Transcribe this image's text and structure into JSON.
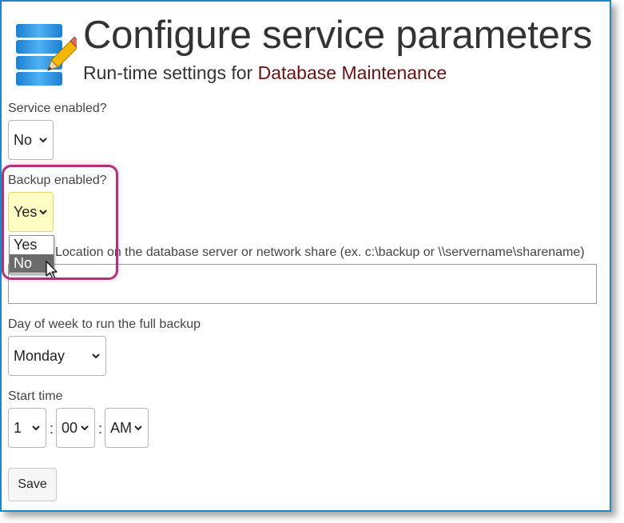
{
  "header": {
    "title": "Configure service parameters",
    "subtitle_prefix": "Run-time settings for",
    "service_name": "Database Maintenance"
  },
  "service_enabled": {
    "label": "Service enabled?",
    "value": "No"
  },
  "backup_enabled": {
    "label": "Backup enabled?",
    "value": "Yes",
    "options": [
      "Yes",
      "No"
    ],
    "hovered_option": "No"
  },
  "backup_location": {
    "label": "Location on the database server or network share (ex. c:\\backup or \\\\servername\\sharename)",
    "value": ""
  },
  "day_of_week": {
    "label": "Day of week to run the full backup",
    "value": "Monday"
  },
  "start_time": {
    "label": "Start time",
    "hour": "1",
    "minute": "00",
    "ampm": "AM",
    "separator": ":"
  },
  "save_button": {
    "label": "Save"
  },
  "colors": {
    "frame_border": "#1e88c7",
    "service_name": "#6a1010",
    "highlight_ring": "#b3307a",
    "selected_field_bg": "#fdfdc4",
    "dropdown_selected_bg": "#6b6b6b"
  },
  "icons": [
    "database-edit-icon",
    "chevron-down-icon",
    "mouse-pointer-icon"
  ]
}
